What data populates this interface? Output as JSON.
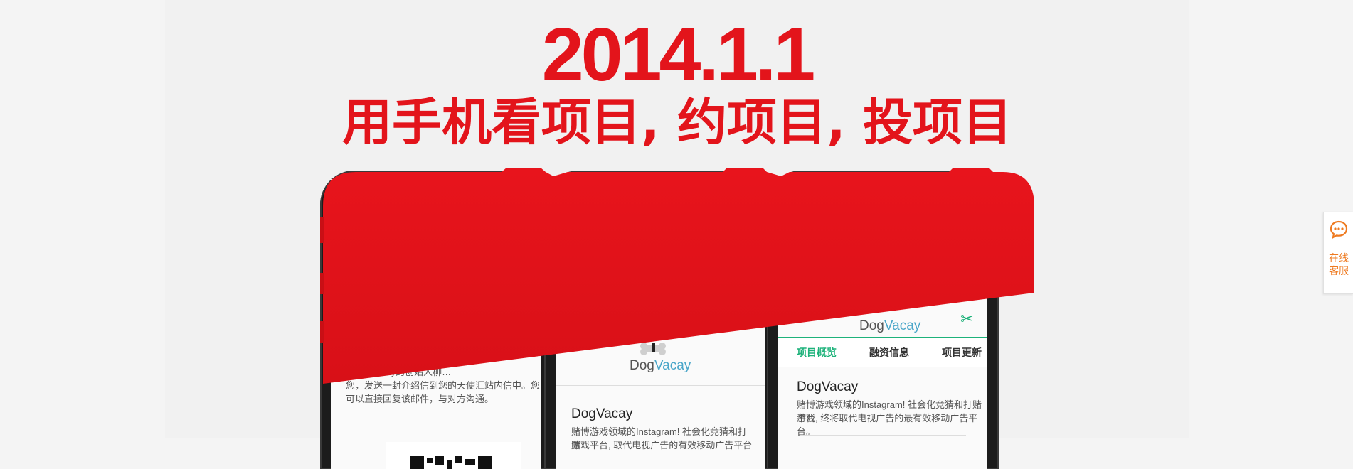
{
  "hero": {
    "date": "2014.1.1",
    "slogan": "用手机看项目, 约项目, 投项目"
  },
  "phones": {
    "left": {
      "text_lines": [
        "ⓘ ……acay的创始人柳…",
        "您，发送一封介绍信到您的天使汇站内信中。您",
        "可以直接回复该邮件，与对方沟通。"
      ]
    },
    "middle": {
      "logo_dog": "Dog",
      "logo_vacay": "Vacay",
      "app_name": "DogVacay",
      "desc_lines": [
        "赌博游戏领域的Instagram! 社会化竞猜和打赌",
        "游戏平台, 取代电视广告的有效移动广告平台"
      ]
    },
    "right": {
      "logo_dog": "Dog",
      "logo_vacay": "Vacay",
      "tabs": [
        "项目概览",
        "融资信息",
        "项目更新"
      ],
      "app_name": "DogVacay",
      "desc_lines": [
        "赌博游戏领域的Instagram! 社会化竞猜和打赌游戏",
        "平台, 终将取代电视广告的最有效移动广告平台。"
      ]
    }
  },
  "support": {
    "icon": "chat-bubble-icon",
    "label": "在线\n客服"
  },
  "colors": {
    "brand_red": "#e3141b",
    "accent_green": "#1db27a",
    "support_orange": "#ee7a20"
  }
}
